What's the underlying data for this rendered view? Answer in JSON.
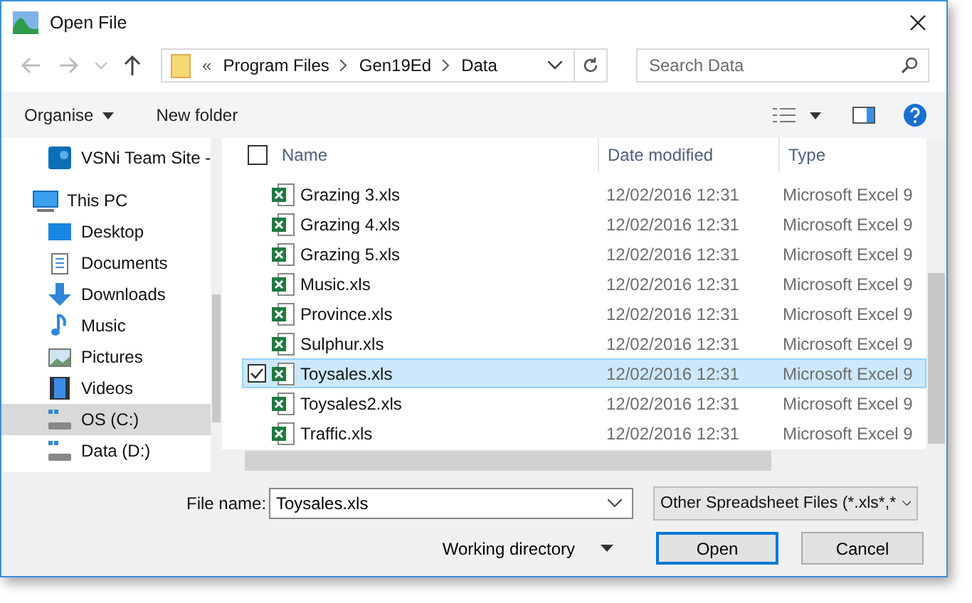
{
  "window": {
    "title": "Open File"
  },
  "address": {
    "overflow": "«",
    "path": [
      "Program Files",
      "Gen19Ed",
      "Data"
    ]
  },
  "search": {
    "placeholder": "Search Data"
  },
  "toolbar": {
    "organise": "Organise",
    "new_folder": "New folder"
  },
  "sidebar": {
    "items": [
      {
        "label": "VSNi Team Site -",
        "kind": "site",
        "selected": false
      },
      {
        "label": "This PC",
        "kind": "pc",
        "selected": false,
        "children": [
          {
            "label": "Desktop",
            "kind": "desktop",
            "selected": false
          },
          {
            "label": "Documents",
            "kind": "documents",
            "selected": false
          },
          {
            "label": "Downloads",
            "kind": "downloads",
            "selected": false
          },
          {
            "label": "Music",
            "kind": "music",
            "selected": false
          },
          {
            "label": "Pictures",
            "kind": "pictures",
            "selected": false
          },
          {
            "label": "Videos",
            "kind": "videos",
            "selected": false
          },
          {
            "label": "OS (C:)",
            "kind": "drive",
            "selected": true
          },
          {
            "label": "Data (D:)",
            "kind": "drive",
            "selected": false
          }
        ]
      }
    ]
  },
  "table": {
    "all_selected": false,
    "columns": [
      "Name",
      "Date modified",
      "Type"
    ],
    "rows": [
      {
        "name": "Grazing 3.xls",
        "date": "12/02/2016 12:31",
        "type": "Microsoft Excel 9",
        "selected": false
      },
      {
        "name": "Grazing 4.xls",
        "date": "12/02/2016 12:31",
        "type": "Microsoft Excel 9",
        "selected": false
      },
      {
        "name": "Grazing 5.xls",
        "date": "12/02/2016 12:31",
        "type": "Microsoft Excel 9",
        "selected": false
      },
      {
        "name": "Music.xls",
        "date": "12/02/2016 12:31",
        "type": "Microsoft Excel 9",
        "selected": false
      },
      {
        "name": "Province.xls",
        "date": "12/02/2016 12:31",
        "type": "Microsoft Excel 9",
        "selected": false
      },
      {
        "name": "Sulphur.xls",
        "date": "12/02/2016 12:31",
        "type": "Microsoft Excel 9",
        "selected": false
      },
      {
        "name": "Toysales.xls",
        "date": "12/02/2016 12:31",
        "type": "Microsoft Excel 9",
        "selected": true
      },
      {
        "name": "Toysales2.xls",
        "date": "12/02/2016 12:31",
        "type": "Microsoft Excel 9",
        "selected": false
      },
      {
        "name": "Traffic.xls",
        "date": "12/02/2016 12:31",
        "type": "Microsoft Excel 9",
        "selected": false
      }
    ]
  },
  "footer": {
    "file_name_label": "File name:",
    "file_name": "Toysales.xls",
    "file_type": "Other Spreadsheet Files (*.xls*,*",
    "working_directory": "Working directory",
    "buttons": [
      "Open",
      "Cancel"
    ]
  }
}
